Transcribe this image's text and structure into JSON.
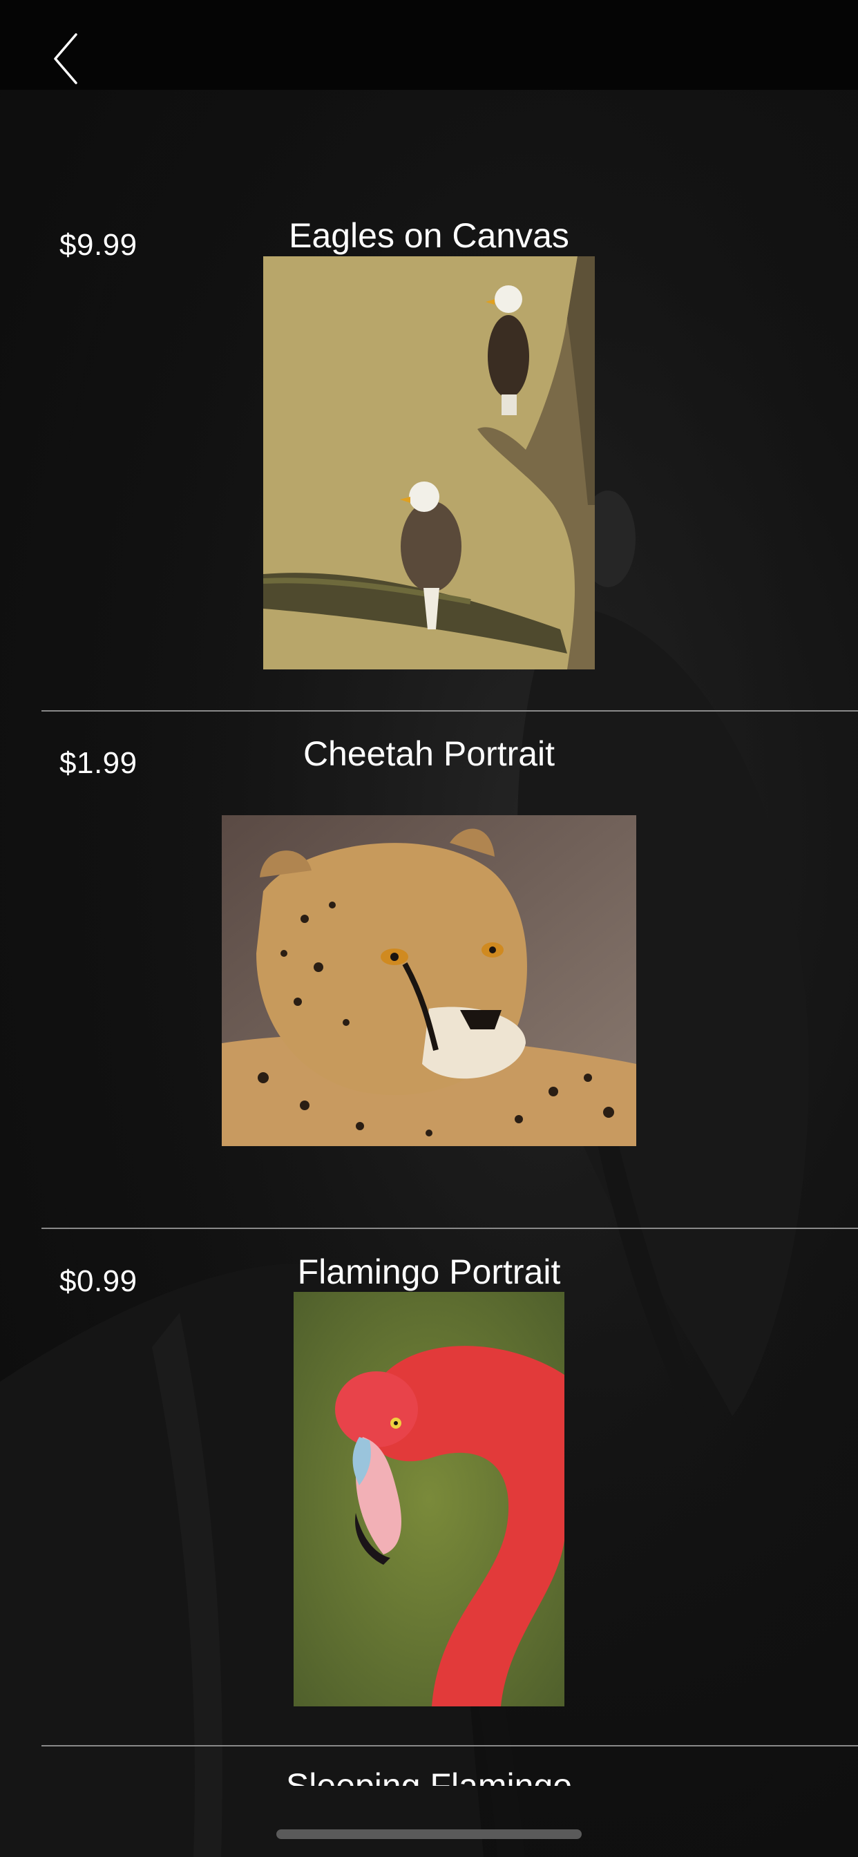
{
  "nav": {
    "back_icon": "chevron-left-icon"
  },
  "items": [
    {
      "price": "$9.99",
      "title": "Eagles on Canvas",
      "image": "eagles-photo"
    },
    {
      "price": "$1.99",
      "title": "Cheetah Portrait",
      "image": "cheetah-photo"
    },
    {
      "price": "$0.99",
      "title": "Flamingo Portrait",
      "image": "flamingo-photo"
    }
  ],
  "next_item": {
    "title": "Sleeping Flamingo"
  },
  "colors": {
    "background": "#0b0b0b",
    "nav_bar": "#050505",
    "divider": "#8a8a8a",
    "text": "#ffffff"
  }
}
